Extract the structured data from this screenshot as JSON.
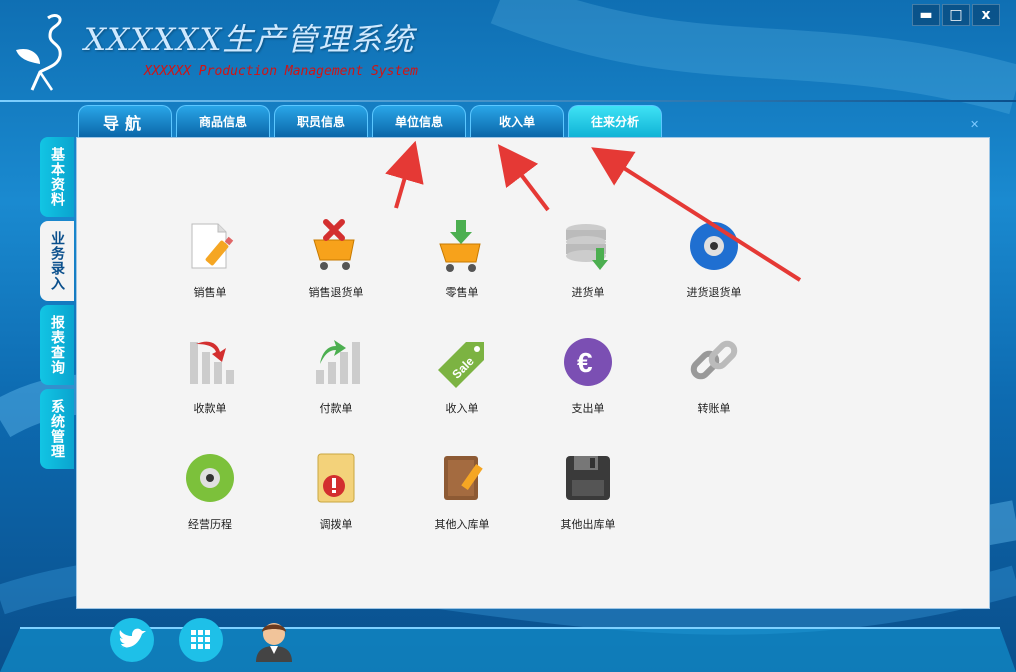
{
  "header": {
    "title_zh": "XXXXXX生产管理系统",
    "title_en": "XXXXXX Production Management System"
  },
  "window_buttons": {
    "minimize": "▬",
    "restore": "□",
    "close": "x"
  },
  "tabs": [
    {
      "label": "导航"
    },
    {
      "label": "商品信息"
    },
    {
      "label": "职员信息"
    },
    {
      "label": "单位信息"
    },
    {
      "label": "收入单"
    },
    {
      "label": "往来分析",
      "active": true
    }
  ],
  "side_tabs": [
    {
      "label": "基本资料"
    },
    {
      "label": "业务录入",
      "active": true
    },
    {
      "label": "报表查询"
    },
    {
      "label": "系统管理"
    }
  ],
  "items": [
    {
      "label": "销售单",
      "icon": "document-pencil-icon"
    },
    {
      "label": "销售退货单",
      "icon": "cart-cancel-icon"
    },
    {
      "label": "零售单",
      "icon": "cart-download-icon"
    },
    {
      "label": "进货单",
      "icon": "database-download-icon"
    },
    {
      "label": "进货退货单",
      "icon": "cd-disc-icon"
    },
    {
      "label": "收款单",
      "icon": "chart-down-icon"
    },
    {
      "label": "付款单",
      "icon": "chart-up-icon"
    },
    {
      "label": "收入单",
      "icon": "sale-tag-icon"
    },
    {
      "label": "支出单",
      "icon": "euro-icon"
    },
    {
      "label": "转账单",
      "icon": "chain-link-icon"
    },
    {
      "label": "经营历程",
      "icon": "dvd-disc-icon"
    },
    {
      "label": "调拨单",
      "icon": "alert-folder-icon"
    },
    {
      "label": "其他入库单",
      "icon": "notebook-pencil-icon"
    },
    {
      "label": "其他出库单",
      "icon": "floppy-disk-icon"
    }
  ],
  "bottom_icons": [
    "twitter-icon",
    "grid-apps-icon",
    "user-avatar-icon"
  ],
  "colors": {
    "accent": "#10b3d6",
    "arrow": "#e53935",
    "panel": "#f4f4f4"
  }
}
